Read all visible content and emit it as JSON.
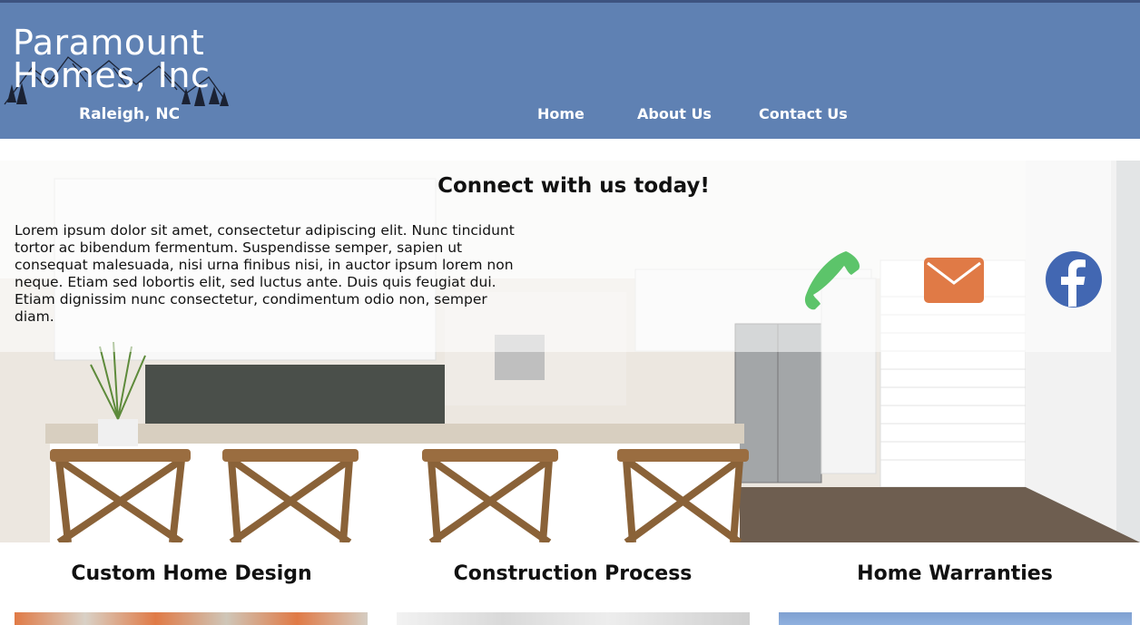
{
  "header": {
    "brand_line1": "Paramount",
    "brand_line2": "Homes, Inc",
    "tagline": "Raleigh, NC",
    "nav": [
      {
        "label": "Home"
      },
      {
        "label": "About Us"
      },
      {
        "label": "Contact Us"
      }
    ],
    "logo_icon": "mountain-trees-icon"
  },
  "hero": {
    "title": "Connect with us today!",
    "text": "Lorem ipsum dolor sit amet, consectetur adipiscing elit. Nunc tincidunt tortor ac bibendum fermentum. Suspendisse semper, sapien ut consequat malesuada, nisi urna finibus nisi, in auctor ipsum lorem non neque. Etiam sed lobortis elit, sed luctus ante. Duis quis feugiat dui. Etiam dignissim nunc consectetur, condimentum odio non, semper diam.",
    "icons": [
      "phone-icon",
      "mail-icon",
      "facebook-icon"
    ],
    "colors": {
      "phone": "#5cc46a",
      "mail": "#e07a46",
      "facebook": "#4267b2"
    }
  },
  "features": [
    {
      "title": "Custom Home Design"
    },
    {
      "title": "Construction Process"
    },
    {
      "title": "Home Warranties"
    }
  ],
  "colors": {
    "header_bg": "#5f81b3",
    "text": "#111111"
  }
}
